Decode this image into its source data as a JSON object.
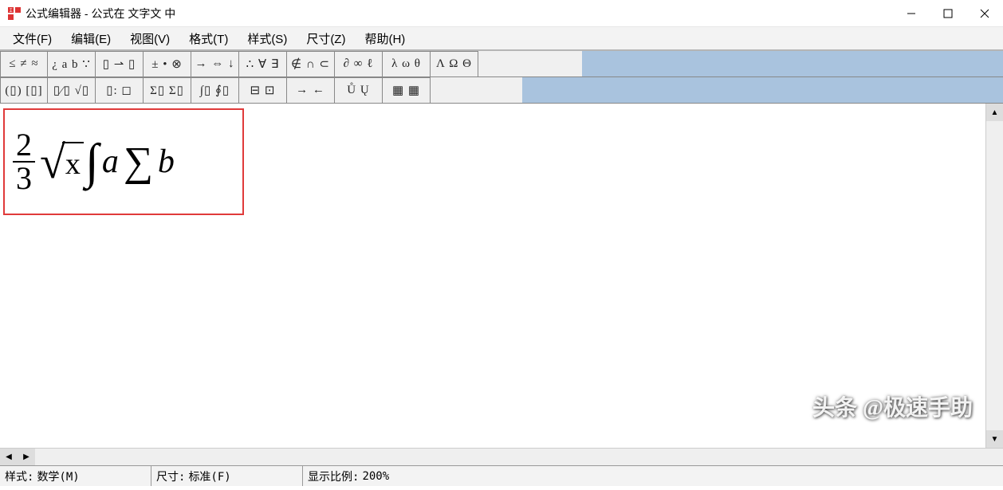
{
  "window": {
    "title": "公式编辑器 - 公式在 文字文 中"
  },
  "menus": [
    "文件(F)",
    "编辑(E)",
    "视图(V)",
    "格式(T)",
    "样式(S)",
    "尺寸(Z)",
    "帮助(H)"
  ],
  "toolbar_row1": [
    "≤ ≠ ≈",
    "¿ a b ∵",
    "▯ ⇀ ▯",
    "± • ⊗",
    "→ ⇔ ↓",
    "∴ ∀ ∃",
    "∉ ∩ ⊂",
    "∂ ∞ ℓ",
    "λ ω θ",
    "Λ Ω Θ"
  ],
  "toolbar_row2": [
    "(▯) [▯]",
    "▯⁄▯ √▯",
    "▯: ◻",
    "Σ▯ Σ▯",
    "∫▯ ∮▯",
    "⊟ ⊡",
    "→ ←",
    "Ů Ų",
    "▦ ▦"
  ],
  "formula": {
    "frac_num": "2",
    "frac_den": "3",
    "sqrt_radicand": "x",
    "integral_var": "a",
    "sum_var": "b"
  },
  "status": {
    "style_label": "样式:",
    "style_value": "数学(M)",
    "size_label": "尺寸:",
    "size_value": "标准(F)",
    "zoom_label": "显示比例:",
    "zoom_value": "200%"
  },
  "watermark": "头条 @极速手助"
}
